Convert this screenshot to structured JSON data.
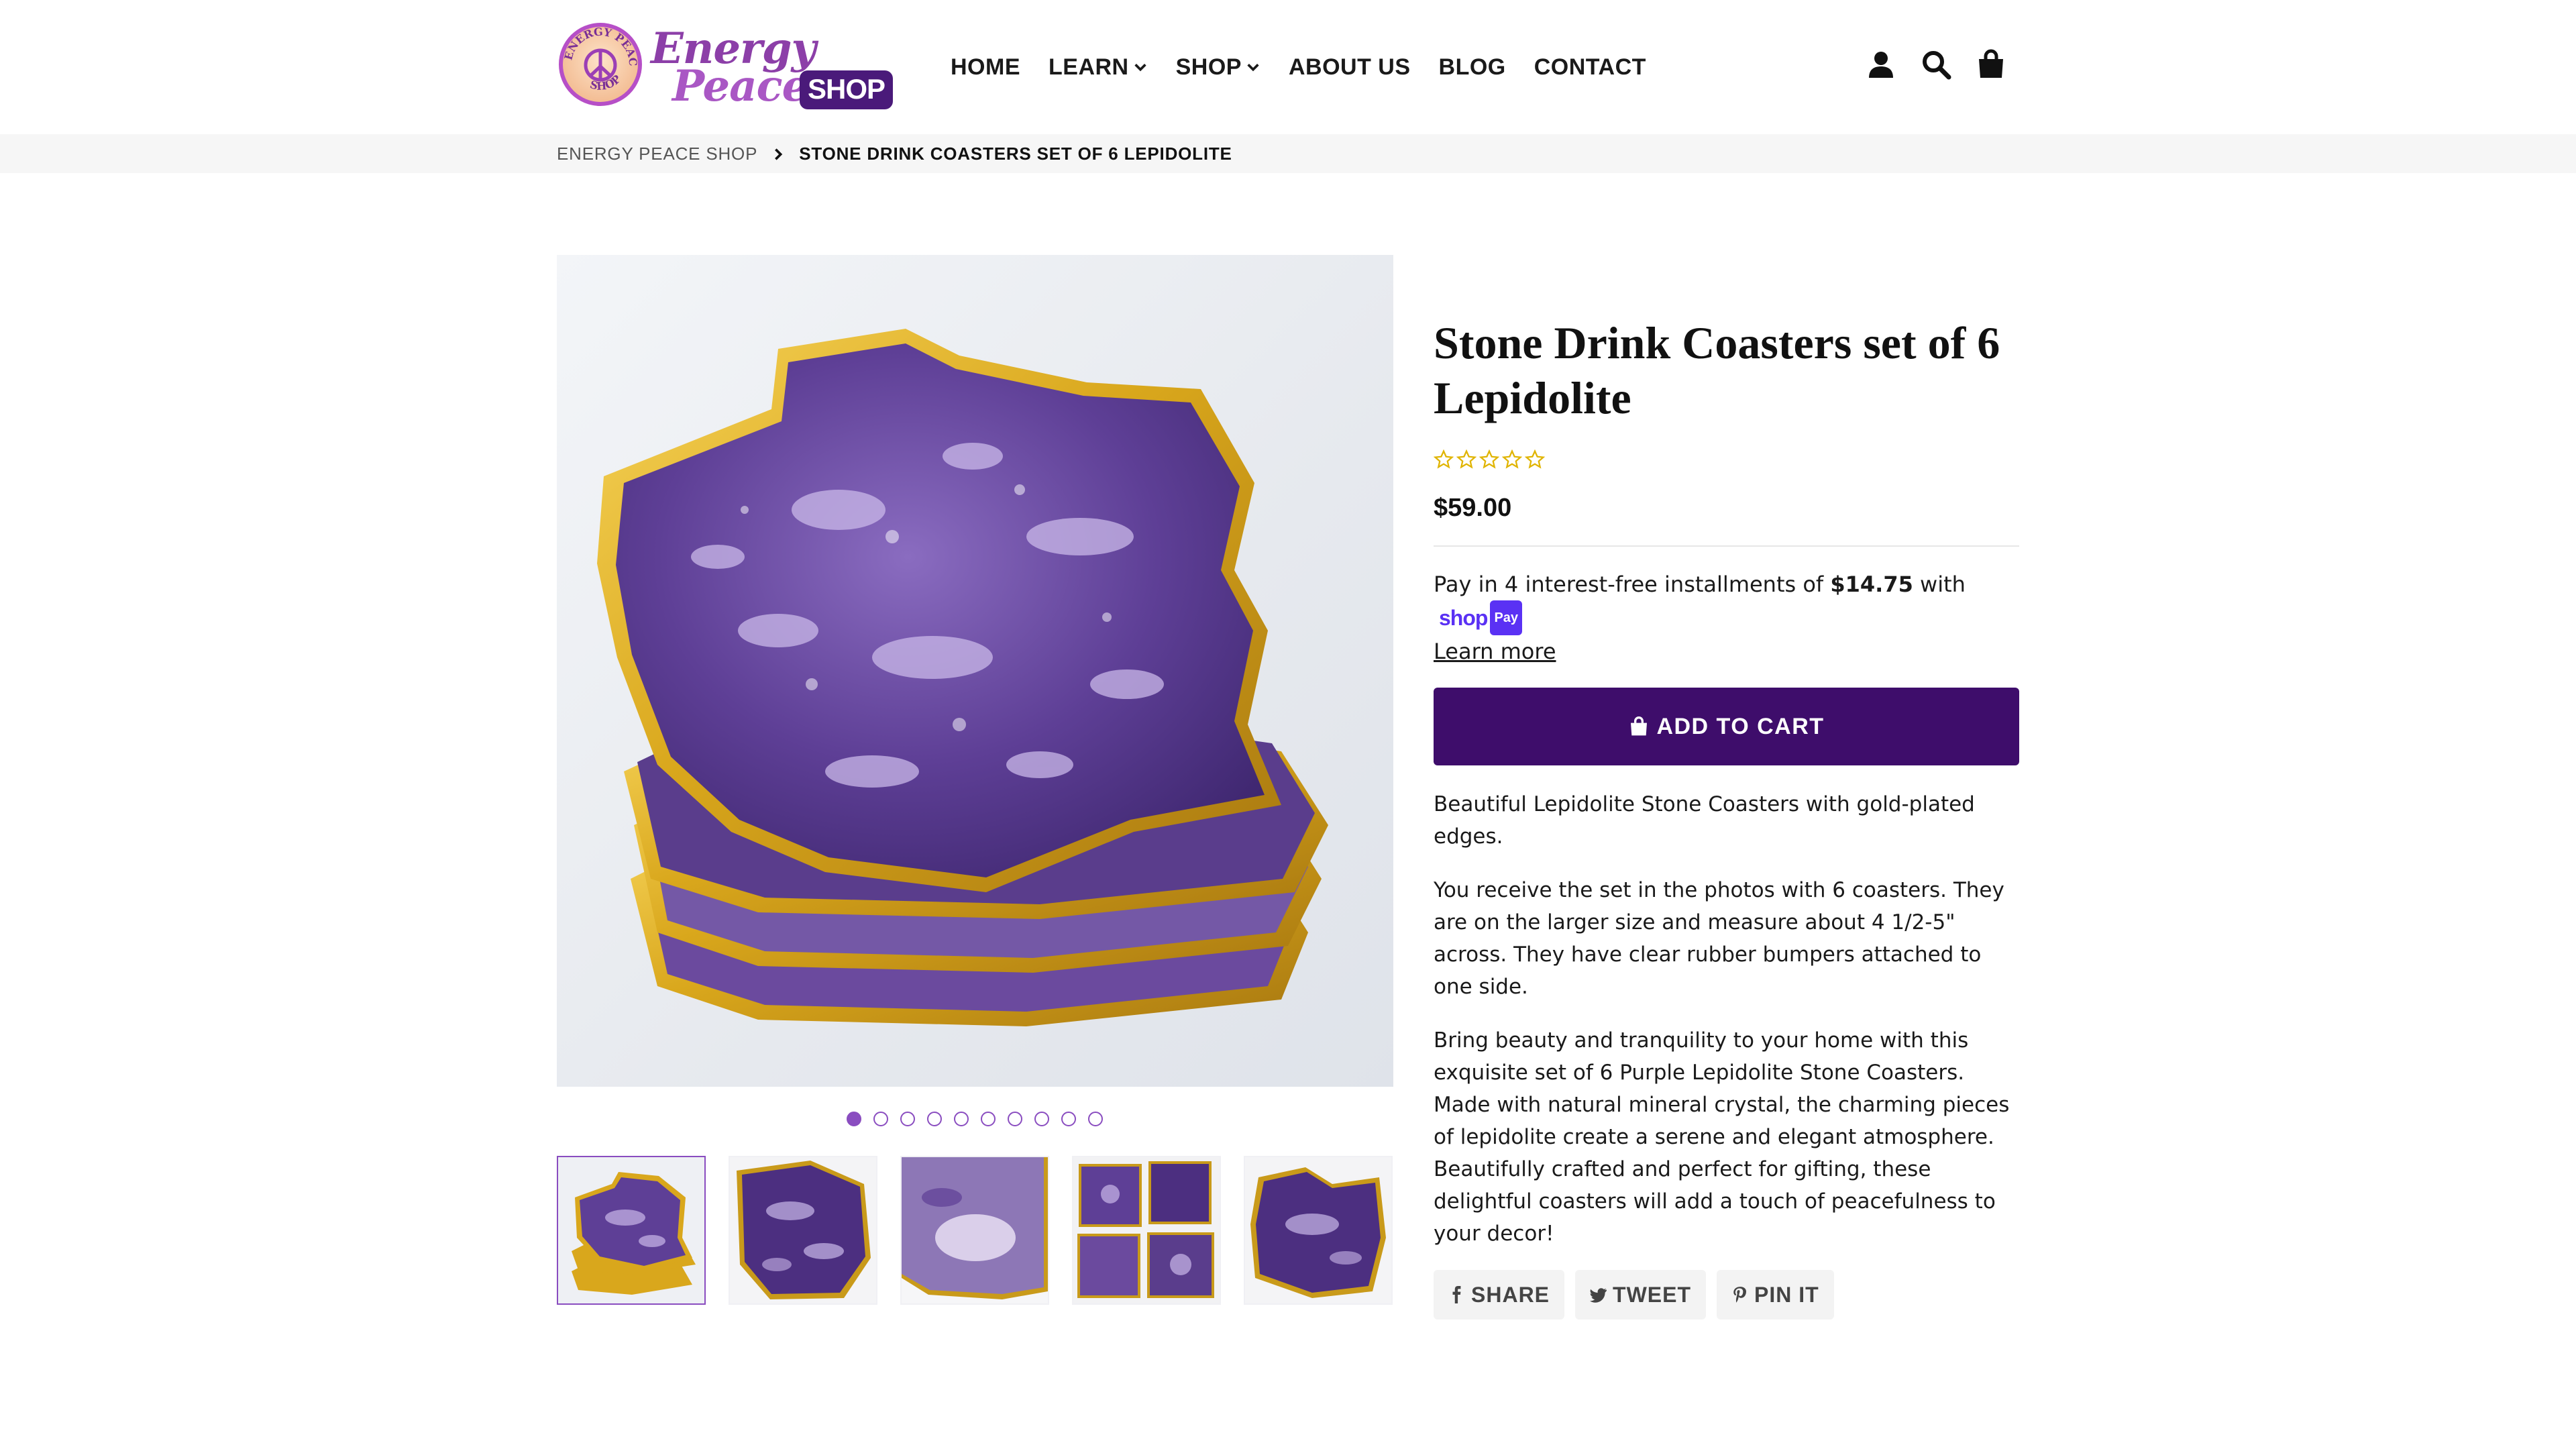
{
  "brand": {
    "line1": "Energy",
    "line2": "Peace",
    "badge": "SHOP",
    "seal_text": "ENERGY PEACE SHOP",
    "colors": {
      "primary": "#8c3fa8",
      "dark": "#3e0d6b",
      "accent": "#5a31f4"
    }
  },
  "nav": {
    "items": [
      {
        "label": "HOME",
        "has_dropdown": false
      },
      {
        "label": "LEARN",
        "has_dropdown": true
      },
      {
        "label": "SHOP",
        "has_dropdown": true
      },
      {
        "label": "ABOUT US",
        "has_dropdown": false
      },
      {
        "label": "BLOG",
        "has_dropdown": false
      },
      {
        "label": "CONTACT",
        "has_dropdown": false
      }
    ],
    "icons": [
      "account-icon",
      "search-icon",
      "cart-icon"
    ]
  },
  "breadcrumb": {
    "home": "ENERGY PEACE SHOP",
    "current": "STONE DRINK COASTERS SET OF 6 LEPIDOLITE"
  },
  "gallery": {
    "image_count": 10,
    "active_index": 0,
    "thumbnails_visible": 5
  },
  "product": {
    "title": "Stone Drink Coasters set of 6 Lepidolite",
    "rating": 0,
    "rating_max": 5,
    "price": "$59.00",
    "installments": {
      "prefix": "Pay in 4 interest-free installments of ",
      "amount": "$14.75",
      "suffix": " with ",
      "provider_shop": "shop",
      "provider_pay": "Pay",
      "learn_more": "Learn more"
    },
    "add_to_cart": "ADD TO CART",
    "description": [
      "Beautiful Lepidolite Stone Coasters with gold-plated edges.",
      "You receive the set in the photos with 6 coasters. They are on the larger size and measure about 4 1/2-5\" across. They have clear rubber bumpers attached to one side.",
      "Bring beauty and tranquility to your home with this exquisite set of 6 Purple Lepidolite Stone Coasters. Made with natural mineral crystal, the charming pieces of lepidolite create a serene and elegant atmosphere. Beautifully crafted and perfect for gifting, these delightful coasters will add a touch of peacefulness to your decor!"
    ],
    "share": {
      "facebook": "SHARE",
      "twitter": "TWEET",
      "pinterest": "PIN IT"
    }
  }
}
